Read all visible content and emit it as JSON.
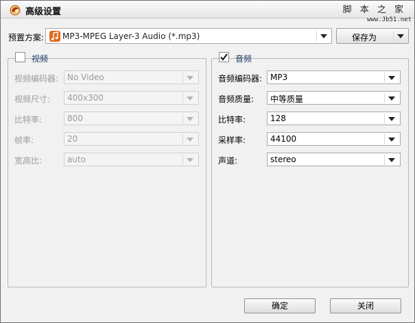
{
  "window": {
    "title": "高级设置",
    "watermark_title": "脚 本 之 家",
    "watermark_url": "www.Jb51.net"
  },
  "preset": {
    "label": "预置方案:",
    "value": "MP3-MPEG Layer-3 Audio (*.mp3)",
    "icon": "music-note-icon",
    "save_as_label": "保存为"
  },
  "video": {
    "title": "视频",
    "checked": false,
    "rows": [
      {
        "label": "视频编码器:",
        "value": "No Video"
      },
      {
        "label": "视频尺寸:",
        "value": "400x300"
      },
      {
        "label": "比特率:",
        "value": "800"
      },
      {
        "label": "帧率:",
        "value": "20"
      },
      {
        "label": "宽高比:",
        "value": "auto"
      }
    ]
  },
  "audio": {
    "title": "音频",
    "checked": true,
    "rows": [
      {
        "label": "音频编码器:",
        "value": "MP3"
      },
      {
        "label": "音频质量:",
        "value": "中等质量"
      },
      {
        "label": "比特率:",
        "value": "128"
      },
      {
        "label": "采样率:",
        "value": "44100"
      },
      {
        "label": "声道:",
        "value": "stereo"
      }
    ]
  },
  "footer": {
    "ok_label": "确定",
    "close_label": "关闭"
  },
  "colors": {
    "accent_orange": "#e0691c",
    "legend_text": "#1f3e6b",
    "disabled_text": "#9b9b9b"
  }
}
